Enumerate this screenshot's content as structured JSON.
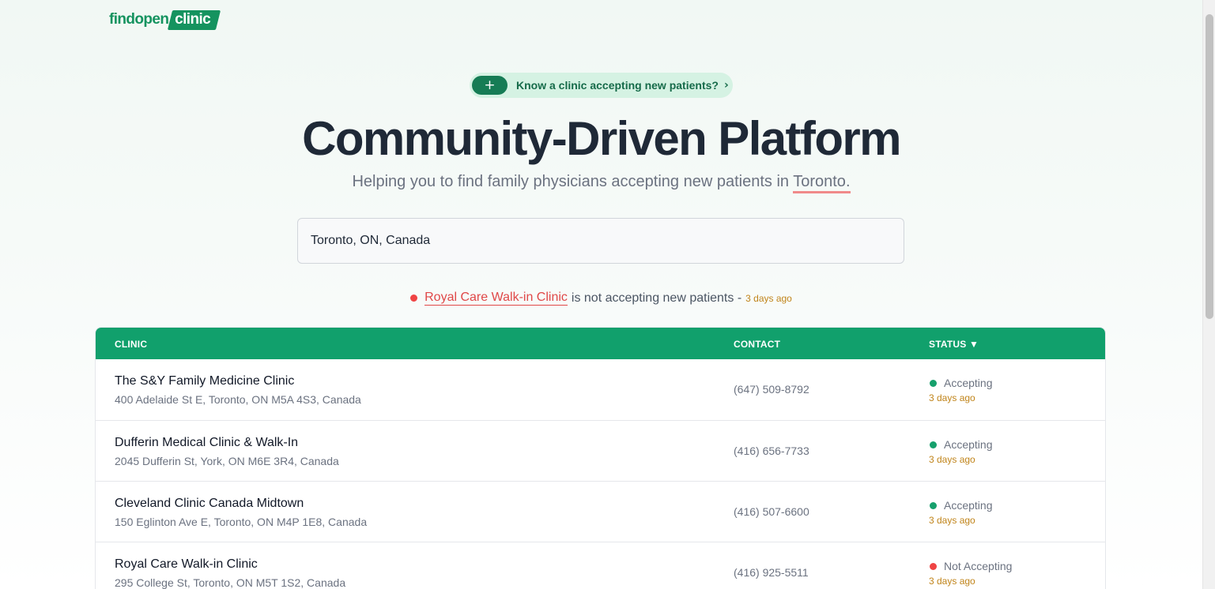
{
  "logo": {
    "part1": "findopen",
    "part2": "clinic"
  },
  "banner": {
    "icon": "+",
    "text": "Know a clinic accepting new patients?",
    "chevron": "›"
  },
  "hero": {
    "title": "Community-Driven Platform",
    "subtitle_prefix": "Helping you to find family physicians accepting new patients in ",
    "city": "Toronto",
    "subtitle_suffix": "."
  },
  "search": {
    "value": "Toronto, ON, Canada"
  },
  "notice": {
    "clinic": "Royal Care Walk-in Clinic",
    "text": " is not accepting new patients - ",
    "ago": "3 days ago"
  },
  "table": {
    "headers": {
      "clinic": "CLINIC",
      "contact": "CONTACT",
      "status": "STATUS ▼"
    },
    "rows": [
      {
        "name": "The S&Y Family Medicine Clinic",
        "address": "400 Adelaide St E, Toronto, ON M5A 4S3, Canada",
        "phone": "(647) 509-8792",
        "status": "Accepting",
        "status_color": "#16a06c",
        "ago": "3 days ago"
      },
      {
        "name": "Dufferin Medical Clinic & Walk-In",
        "address": "2045 Dufferin St, York, ON M6E 3R4, Canada",
        "phone": "(416) 656-7733",
        "status": "Accepting",
        "status_color": "#16a06c",
        "ago": "3 days ago"
      },
      {
        "name": "Cleveland Clinic Canada Midtown",
        "address": "150 Eglinton Ave E, Toronto, ON M4P 1E8, Canada",
        "phone": "(416) 507-6600",
        "status": "Accepting",
        "status_color": "#16a06c",
        "ago": "3 days ago"
      },
      {
        "name": "Royal Care Walk-in Clinic",
        "address": "295 College St, Toronto, ON M5T 1S2, Canada",
        "phone": "(416) 925-5511",
        "status": "Not Accepting",
        "status_color": "#ef4444",
        "ago": "3 days ago"
      }
    ]
  },
  "colors": {
    "brand": "#15935f",
    "header": "#11a06c",
    "accepting": "#16a06c",
    "not_accepting": "#ef4444",
    "ago": "#c0841a"
  }
}
